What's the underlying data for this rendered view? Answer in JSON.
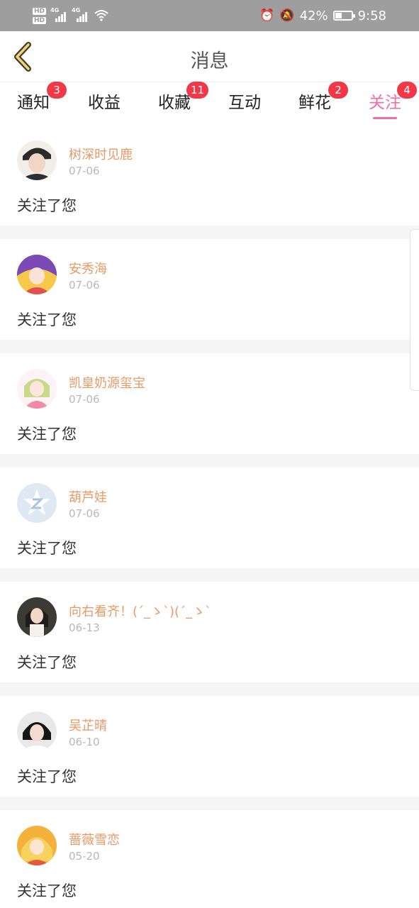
{
  "status_bar": {
    "hd1": "HD",
    "hd2": "HD",
    "sig1": "4G",
    "sig2": "4G",
    "battery_pct": "42%",
    "battery_level": 0.42,
    "time": "9:58",
    "icons": [
      "alarm-icon",
      "mute-icon",
      "wifi-icon"
    ]
  },
  "header": {
    "title": "消息"
  },
  "tabs": [
    {
      "label": "通知",
      "badge": "3"
    },
    {
      "label": "收益",
      "badge": ""
    },
    {
      "label": "收藏",
      "badge": "11"
    },
    {
      "label": "互动",
      "badge": ""
    },
    {
      "label": "鲜花",
      "badge": "2"
    },
    {
      "label": "关注",
      "badge": "4",
      "active": true
    }
  ],
  "items": [
    {
      "name": "树深时见鹿",
      "date": "07-06",
      "message": "关注了您"
    },
    {
      "name": "安秀海",
      "date": "07-06",
      "message": "关注了您"
    },
    {
      "name": "凯皇奶源玺宝",
      "date": "07-06",
      "message": "关注了您"
    },
    {
      "name": "葫芦娃",
      "date": "07-06",
      "message": "关注了您"
    },
    {
      "name": "向右看齐！(´_ゝ`)(´_ゝ`",
      "date": "06-13",
      "message": "关注了您"
    },
    {
      "name": "吴芷晴",
      "date": "06-10",
      "message": "关注了您"
    },
    {
      "name": "蔷薇雪恋",
      "date": "05-20",
      "message": "关注了您"
    }
  ],
  "colors": {
    "accent": "#f26ca6",
    "name": "#e89a66",
    "badge": "#f23847",
    "statusbar": "#9e9e9e"
  }
}
